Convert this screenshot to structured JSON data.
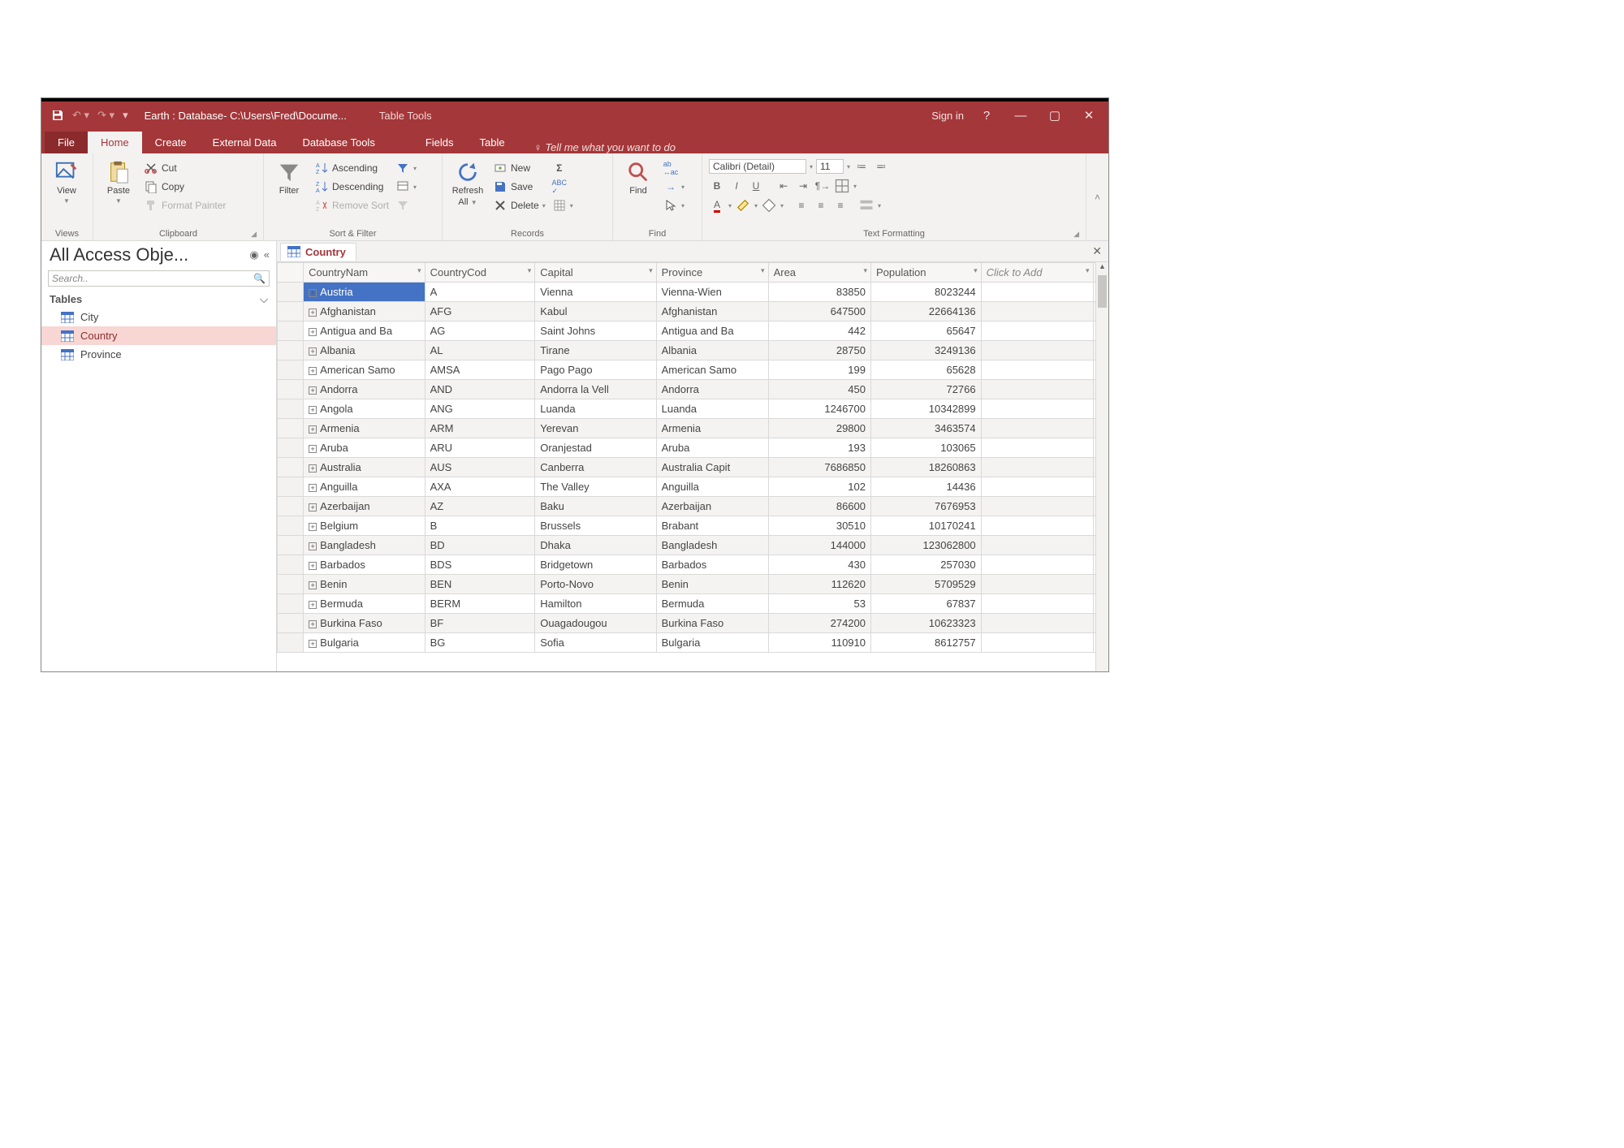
{
  "titlebar": {
    "title": "Earth : Database- C:\\Users\\Fred\\Docume...",
    "tabletools": "Table Tools",
    "signin": "Sign in"
  },
  "tabs": {
    "file": "File",
    "home": "Home",
    "create": "Create",
    "external": "External Data",
    "dbtools": "Database Tools",
    "fields": "Fields",
    "table": "Table",
    "tellme": "Tell me what you want to do"
  },
  "ribbon": {
    "views": {
      "label": "Views",
      "view": "View"
    },
    "clipboard": {
      "label": "Clipboard",
      "paste": "Paste",
      "cut": "Cut",
      "copy": "Copy",
      "fmt": "Format Painter"
    },
    "sort": {
      "label": "Sort & Filter",
      "filter": "Filter",
      "asc": "Ascending",
      "desc": "Descending",
      "remove": "Remove Sort"
    },
    "records": {
      "label": "Records",
      "refresh": "Refresh",
      "all": "All",
      "new": "New",
      "save": "Save",
      "delete": "Delete"
    },
    "find": {
      "label": "Find",
      "find": "Find"
    },
    "text": {
      "label": "Text Formatting",
      "font": "Calibri (Detail)",
      "size": "11"
    }
  },
  "nav": {
    "title": "All Access Obje...",
    "searchplaceholder": "Search..",
    "tables": "Tables",
    "items": [
      {
        "label": "City"
      },
      {
        "label": "Country"
      },
      {
        "label": "Province"
      }
    ]
  },
  "doc": {
    "tab": "Country"
  },
  "grid": {
    "headers": [
      "CountryNam",
      "CountryCod",
      "Capital",
      "Province",
      "Area",
      "Population",
      "Click to Add"
    ],
    "rows": [
      {
        "name": "Austria",
        "code": "A",
        "capital": "Vienna",
        "province": "Vienna-Wien",
        "area": 83850,
        "pop": 8023244,
        "sel": true
      },
      {
        "name": "Afghanistan",
        "code": "AFG",
        "capital": "Kabul",
        "province": "Afghanistan",
        "area": 647500,
        "pop": 22664136
      },
      {
        "name": "Antigua and Ba",
        "code": "AG",
        "capital": "Saint Johns",
        "province": "Antigua and Ba",
        "area": 442,
        "pop": 65647
      },
      {
        "name": "Albania",
        "code": "AL",
        "capital": "Tirane",
        "province": "Albania",
        "area": 28750,
        "pop": 3249136
      },
      {
        "name": "American Samo",
        "code": "AMSA",
        "capital": "Pago Pago",
        "province": "American Samo",
        "area": 199,
        "pop": 65628
      },
      {
        "name": "Andorra",
        "code": "AND",
        "capital": "Andorra la Vell",
        "province": "Andorra",
        "area": 450,
        "pop": 72766
      },
      {
        "name": "Angola",
        "code": "ANG",
        "capital": "Luanda",
        "province": "Luanda",
        "area": 1246700,
        "pop": 10342899
      },
      {
        "name": "Armenia",
        "code": "ARM",
        "capital": "Yerevan",
        "province": "Armenia",
        "area": 29800,
        "pop": 3463574
      },
      {
        "name": "Aruba",
        "code": "ARU",
        "capital": "Oranjestad",
        "province": "Aruba",
        "area": 193,
        "pop": 103065
      },
      {
        "name": "Australia",
        "code": "AUS",
        "capital": "Canberra",
        "province": "Australia Capit",
        "area": 7686850,
        "pop": 18260863
      },
      {
        "name": "Anguilla",
        "code": "AXA",
        "capital": "The Valley",
        "province": "Anguilla",
        "area": 102,
        "pop": 14436
      },
      {
        "name": "Azerbaijan",
        "code": "AZ",
        "capital": "Baku",
        "province": "Azerbaijan",
        "area": 86600,
        "pop": 7676953
      },
      {
        "name": "Belgium",
        "code": "B",
        "capital": "Brussels",
        "province": "Brabant",
        "area": 30510,
        "pop": 10170241
      },
      {
        "name": "Bangladesh",
        "code": "BD",
        "capital": "Dhaka",
        "province": "Bangladesh",
        "area": 144000,
        "pop": 123062800
      },
      {
        "name": "Barbados",
        "code": "BDS",
        "capital": "Bridgetown",
        "province": "Barbados",
        "area": 430,
        "pop": 257030
      },
      {
        "name": "Benin",
        "code": "BEN",
        "capital": "Porto-Novo",
        "province": "Benin",
        "area": 112620,
        "pop": 5709529
      },
      {
        "name": "Bermuda",
        "code": "BERM",
        "capital": "Hamilton",
        "province": "Bermuda",
        "area": 53,
        "pop": 67837
      },
      {
        "name": "Burkina Faso",
        "code": "BF",
        "capital": "Ouagadougou",
        "province": "Burkina Faso",
        "area": 274200,
        "pop": 10623323
      },
      {
        "name": "Bulgaria",
        "code": "BG",
        "capital": "Sofia",
        "province": "Bulgaria",
        "area": 110910,
        "pop": 8612757
      }
    ]
  }
}
